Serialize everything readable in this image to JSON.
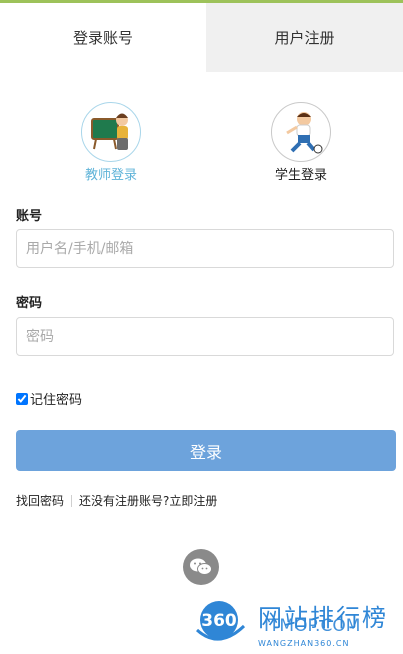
{
  "tabs": [
    {
      "label": "登录账号",
      "active": true
    },
    {
      "label": "用户注册",
      "active": false
    }
  ],
  "roles": [
    {
      "label": "教师登录",
      "icon": "teacher-icon",
      "selected": true
    },
    {
      "label": "学生登录",
      "icon": "student-icon",
      "selected": false
    }
  ],
  "form": {
    "account_label": "账号",
    "account_placeholder": "用户名/手机/邮箱",
    "password_label": "密码",
    "password_placeholder": "密码",
    "remember_label": "记住密码",
    "remember_checked": true,
    "login_button": "登录"
  },
  "links": {
    "forgot": "找回密码",
    "register": "还没有注册账号?立即注册"
  },
  "social": {
    "icon": "wechat-icon"
  },
  "watermark": {
    "logo_text": "360",
    "title": "网站排行榜",
    "subtitle": "ITMOP.COM",
    "url": "WANGZHAN360.CN"
  },
  "colors": {
    "primary_button": "#6da3dc",
    "selected_role_text": "#5fb3d8",
    "top_accent": "#9dc25a",
    "watermark": "#2f86d6"
  }
}
